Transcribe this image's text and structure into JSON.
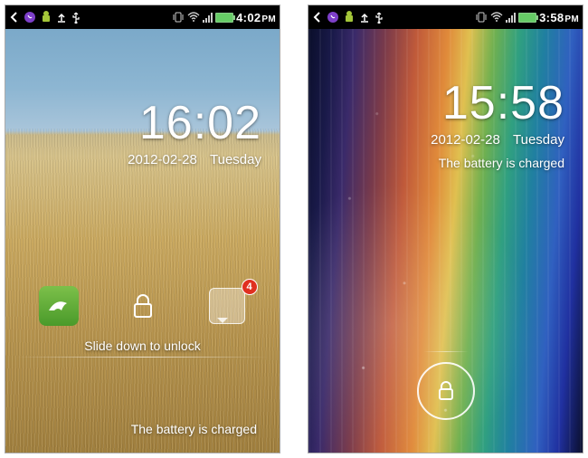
{
  "left": {
    "status": {
      "time": "4:02",
      "ampm": "PM"
    },
    "lock": {
      "time": "16:02",
      "date": "2012-02-28",
      "day": "Tuesday",
      "hint": "Slide down to unlock",
      "charge": "The battery is charged",
      "sms_badge": "4"
    }
  },
  "right": {
    "status": {
      "time": "3:58",
      "ampm": "PM"
    },
    "lock": {
      "time": "15:58",
      "date": "2012-02-28",
      "day": "Tuesday",
      "charge": "The battery is charged"
    }
  }
}
